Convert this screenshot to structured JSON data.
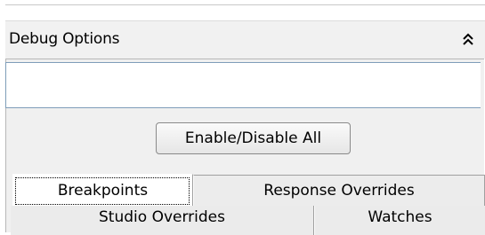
{
  "panel": {
    "title": "Debug Options",
    "collapse_icon": "double-chevron-up-icon"
  },
  "debug_input": {
    "value": "",
    "placeholder": ""
  },
  "buttons": {
    "enable_disable_all": "Enable/Disable All"
  },
  "tabs": {
    "row1": [
      {
        "label": "Breakpoints",
        "selected": true
      },
      {
        "label": "Response Overrides",
        "selected": false
      }
    ],
    "row2": [
      {
        "label": "Studio Overrides",
        "selected": false
      },
      {
        "label": "Watches",
        "selected": false
      }
    ]
  }
}
